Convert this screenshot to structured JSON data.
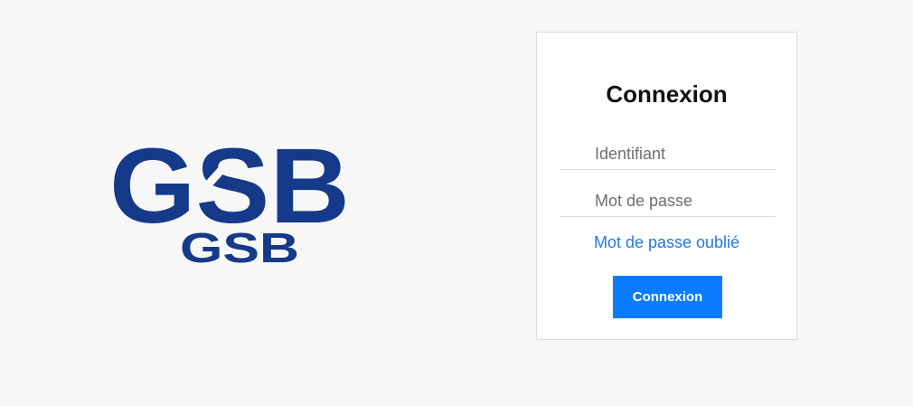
{
  "logo": {
    "main_text": "GSB",
    "sub_text": "GSB",
    "color": "#163a8a"
  },
  "login": {
    "title": "Connexion",
    "username_placeholder": "Identifiant",
    "password_placeholder": "Mot de passe",
    "forgot_link": "Mot de passe oublié",
    "submit_label": "Connexion",
    "accent_color": "#0a7cff",
    "link_color": "#1f7ae0"
  }
}
